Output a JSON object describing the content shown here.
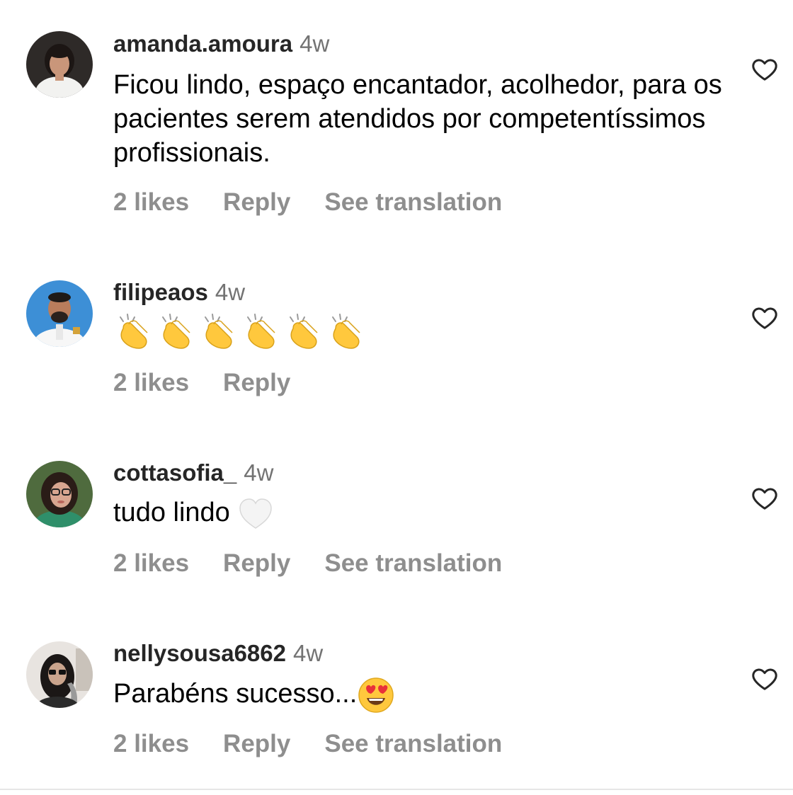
{
  "comments": [
    {
      "username": "amanda.amoura",
      "time": "4w",
      "text": "Ficou lindo, espaço encantador, acolhedor, para os pacientes serem atendidos por competentíssimos profissionais.",
      "likes": "2 likes",
      "reply": "Reply",
      "translate": "See translation"
    },
    {
      "username": "filipeaos",
      "time": "4w",
      "emoji": "clapping-hands x6",
      "likes": "2 likes",
      "reply": "Reply"
    },
    {
      "username": "cottasofia_",
      "time": "4w",
      "text": "tudo lindo",
      "emoji": "white-heart",
      "likes": "2 likes",
      "reply": "Reply",
      "translate": "See translation"
    },
    {
      "username": "nellysousa6862",
      "time": "4w",
      "text": "Parabéns sucesso...",
      "emoji": "heart-eyes-face",
      "likes": "2 likes",
      "reply": "Reply",
      "translate": "See translation"
    }
  ],
  "colors": {
    "username": "#262626",
    "meta": "#737373",
    "action": "#8e8e8e",
    "emoji_yellow": "#FFC83D"
  }
}
